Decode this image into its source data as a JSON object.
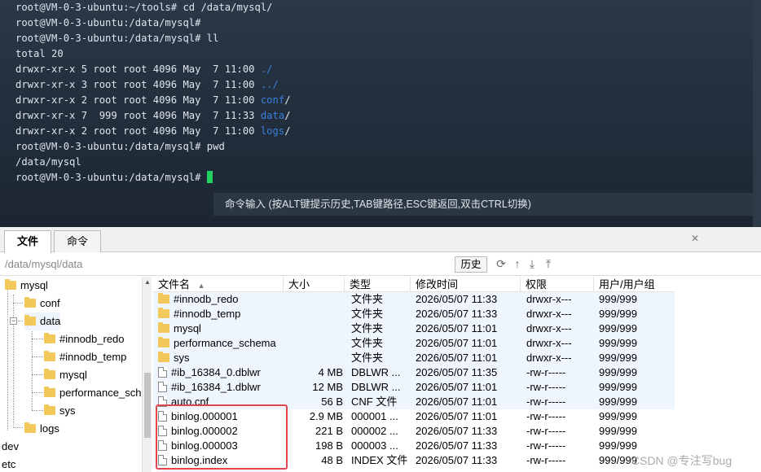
{
  "terminal": {
    "lines": [
      [
        {
          "t": "root@VM-0-3-ubuntu:~/tools# cd /data/mysql/"
        }
      ],
      [
        {
          "t": "root@VM-0-3-ubuntu:/data/mysql#"
        }
      ],
      [
        {
          "t": "root@VM-0-3-ubuntu:/data/mysql# ll"
        }
      ],
      [
        {
          "t": "total 20"
        }
      ],
      [
        {
          "t": "drwxr-xr-x 5 root root 4096 May  7 11:00 "
        },
        {
          "t": "./",
          "c": "blue"
        }
      ],
      [
        {
          "t": "drwxr-xr-x 3 root root 4096 May  7 11:00 "
        },
        {
          "t": "../",
          "c": "blue"
        }
      ],
      [
        {
          "t": "drwxr-xr-x 2 root root 4096 May  7 11:00 "
        },
        {
          "t": "conf",
          "c": "blue"
        },
        {
          "t": "/"
        }
      ],
      [
        {
          "t": "drwxr-xr-x 7  999 root 4096 May  7 11:33 "
        },
        {
          "t": "data",
          "c": "blue"
        },
        {
          "t": "/"
        }
      ],
      [
        {
          "t": "drwxr-xr-x 2 root root 4096 May  7 11:00 "
        },
        {
          "t": "logs",
          "c": "blue"
        },
        {
          "t": "/"
        }
      ],
      [
        {
          "t": "root@VM-0-3-ubuntu:/data/mysql# pwd"
        }
      ],
      [
        {
          "t": "/data/mysql"
        }
      ],
      [
        {
          "t": "root@VM-0-3-ubuntu:/data/mysql# "
        },
        {
          "t": "",
          "c": "cursor"
        }
      ]
    ],
    "command_hint": "命令输入 (按ALT键提示历史,TAB键路径,ESC键返回,双击CTRL切换)",
    "colors": {
      "link": "#3b7fe0",
      "cursor": "#23d160"
    }
  },
  "tabs": {
    "files": "文件",
    "command": "命令"
  },
  "path_bar": {
    "path": "/data/mysql/data",
    "history_label": "历史"
  },
  "tree": {
    "items": [
      {
        "label": "mysql",
        "level": 0
      },
      {
        "label": "conf",
        "level": 1
      },
      {
        "label": "data",
        "level": 1,
        "expanded": true,
        "selected": true
      },
      {
        "label": "#innodb_redo",
        "level": 2
      },
      {
        "label": "#innodb_temp",
        "level": 2
      },
      {
        "label": "mysql",
        "level": 2
      },
      {
        "label": "performance_sch",
        "level": 2
      },
      {
        "label": "sys",
        "level": 2
      },
      {
        "label": "logs",
        "level": 1
      },
      {
        "label": "dev",
        "level": -1
      },
      {
        "label": "etc",
        "level": -1
      }
    ]
  },
  "file_list": {
    "columns": [
      "文件名",
      "大小",
      "类型",
      "修改时间",
      "权限",
      "用户/用户组"
    ],
    "sort_indicator": "▲",
    "rows": [
      {
        "name": "#innodb_redo",
        "size": "",
        "type": "文件夹",
        "modified": "2026/05/07 11:33",
        "perm": "drwxr-x---",
        "owner": "999/999",
        "kind": "folder"
      },
      {
        "name": "#innodb_temp",
        "size": "",
        "type": "文件夹",
        "modified": "2026/05/07 11:33",
        "perm": "drwxr-x---",
        "owner": "999/999",
        "kind": "folder"
      },
      {
        "name": "mysql",
        "size": "",
        "type": "文件夹",
        "modified": "2026/05/07 11:01",
        "perm": "drwxr-x---",
        "owner": "999/999",
        "kind": "folder"
      },
      {
        "name": "performance_schema",
        "size": "",
        "type": "文件夹",
        "modified": "2026/05/07 11:01",
        "perm": "drwxr-x---",
        "owner": "999/999",
        "kind": "folder"
      },
      {
        "name": "sys",
        "size": "",
        "type": "文件夹",
        "modified": "2026/05/07 11:01",
        "perm": "drwxr-x---",
        "owner": "999/999",
        "kind": "folder"
      },
      {
        "name": "#ib_16384_0.dblwr",
        "size": "4 MB",
        "type": "DBLWR ...",
        "modified": "2026/05/07 11:35",
        "perm": "-rw-r-----",
        "owner": "999/999",
        "kind": "file"
      },
      {
        "name": "#ib_16384_1.dblwr",
        "size": "12 MB",
        "type": "DBLWR ...",
        "modified": "2026/05/07 11:01",
        "perm": "-rw-r-----",
        "owner": "999/999",
        "kind": "file"
      },
      {
        "name": "auto.cnf",
        "size": "56 B",
        "type": "CNF 文件",
        "modified": "2026/05/07 11:01",
        "perm": "-rw-r-----",
        "owner": "999/999",
        "kind": "file"
      },
      {
        "name": "binlog.000001",
        "size": "2.9 MB",
        "type": "000001 ...",
        "modified": "2026/05/07 11:01",
        "perm": "-rw-r-----",
        "owner": "999/999",
        "kind": "file"
      },
      {
        "name": "binlog.000002",
        "size": "221 B",
        "type": "000002 ...",
        "modified": "2026/05/07 11:33",
        "perm": "-rw-r-----",
        "owner": "999/999",
        "kind": "file"
      },
      {
        "name": "binlog.000003",
        "size": "198 B",
        "type": "000003 ...",
        "modified": "2026/05/07 11:33",
        "perm": "-rw-r-----",
        "owner": "999/999",
        "kind": "file"
      },
      {
        "name": "binlog.index",
        "size": "48 B",
        "type": "INDEX 文件",
        "modified": "2026/05/07 11:33",
        "perm": "-rw-r-----",
        "owner": "999/999",
        "kind": "file"
      }
    ]
  },
  "watermark": "CSDN @专注写bug",
  "colors": {
    "highlight_border": "#e0474a",
    "folder": "#f3c85a",
    "row_highlight": "#eef5fd"
  }
}
